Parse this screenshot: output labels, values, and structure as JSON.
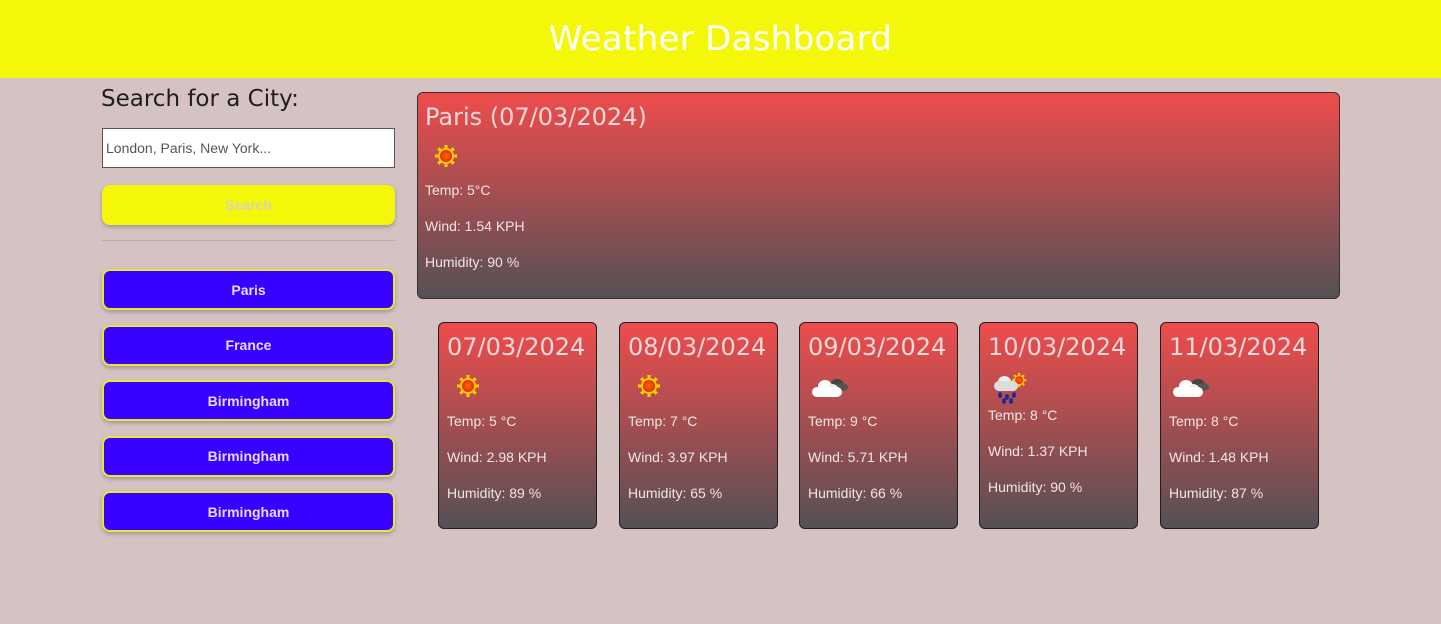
{
  "header": {
    "title": "Weather Dashboard"
  },
  "sidebar": {
    "heading": "Search for a City:",
    "search_placeholder": "London, Paris, New York...",
    "search_button_label": "Search",
    "history": [
      "Paris",
      "France",
      "Birmingham",
      "Birmingham",
      "Birmingham"
    ]
  },
  "today": {
    "title": "Paris (07/03/2024)",
    "icon": "sun-icon",
    "temp": "Temp: 5°C",
    "wind": "Wind: 1.54 KPH",
    "humidity": "Humidity: 90 %"
  },
  "forecast": [
    {
      "date": "07/03/2024",
      "icon": "sun-icon",
      "temp": "Temp: 5 °C",
      "wind": "Wind: 2.98 KPH",
      "humidity": "Humidity: 89 %"
    },
    {
      "date": "08/03/2024",
      "icon": "sun-icon",
      "temp": "Temp: 7 °C",
      "wind": "Wind: 3.97 KPH",
      "humidity": "Humidity: 65 %"
    },
    {
      "date": "09/03/2024",
      "icon": "cloud-icon",
      "temp": "Temp: 9 °C",
      "wind": "Wind: 5.71 KPH",
      "humidity": "Humidity: 66 %"
    },
    {
      "date": "10/03/2024",
      "icon": "rain-icon",
      "temp": "Temp: 8 °C",
      "wind": "Wind: 1.37 KPH",
      "humidity": "Humidity: 90 %"
    },
    {
      "date": "11/03/2024",
      "icon": "cloud-icon",
      "temp": "Temp: 8 °C",
      "wind": "Wind: 1.48 KPH",
      "humidity": "Humidity: 87 %"
    }
  ],
  "colors": {
    "header_bg": "#f4f707",
    "page_bg": "#d5c3c3",
    "history_button_bg": "#3700ff",
    "card_gradient_top": "#ef4c4c",
    "card_gradient_bottom": "#555055"
  }
}
